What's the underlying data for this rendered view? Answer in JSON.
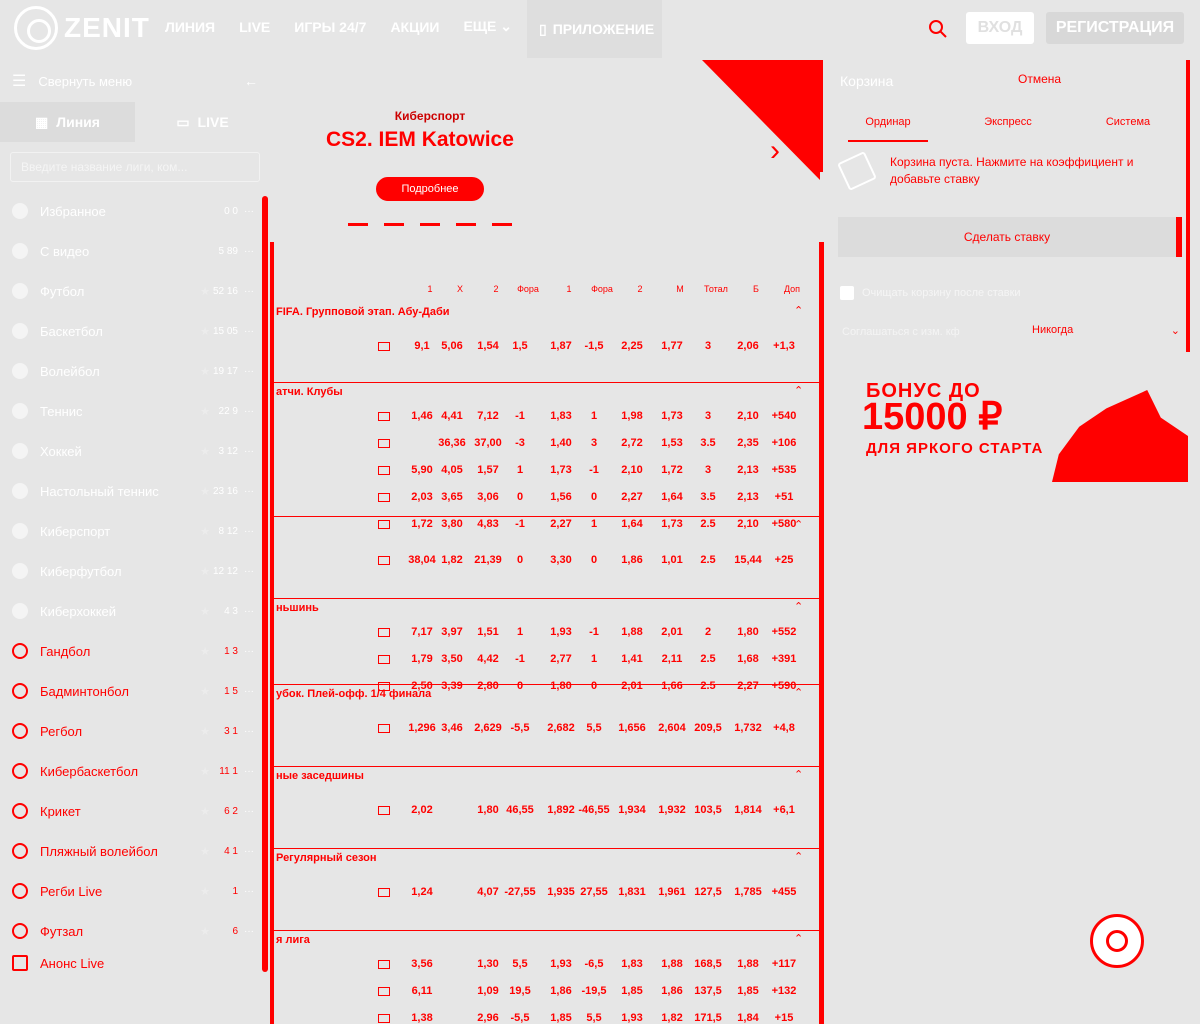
{
  "header": {
    "logo_text": "ZENIT",
    "nav": [
      "Линия",
      "LIVE",
      "Игры 24/7",
      "Акции",
      "Еще"
    ],
    "app_label": "Приложение",
    "login": "Вход",
    "register": "Регистрация"
  },
  "sidebar": {
    "collapse_label": "Свернуть меню",
    "tabs": [
      "Линия",
      "LIVE"
    ],
    "search_placeholder": "Введите название лиги, ком...",
    "sports": [
      {
        "name": "Избранное",
        "count": "0 0"
      },
      {
        "name": "С видео",
        "count": "5 89"
      },
      {
        "name": "Футбол",
        "count": "52 16"
      },
      {
        "name": "Баскетбол",
        "count": "15 05"
      },
      {
        "name": "Волейбол",
        "count": "19 17"
      },
      {
        "name": "Теннис",
        "count": "22 9"
      },
      {
        "name": "Хоккей",
        "count": "3 12"
      },
      {
        "name": "Настольный теннис",
        "count": "23 16"
      },
      {
        "name": "Киберспорт",
        "count": "8 12"
      },
      {
        "name": "Киберфутбол",
        "count": "12 12"
      },
      {
        "name": "Киберхоккей",
        "count": "4 3"
      },
      {
        "name": "Гандбол",
        "count": "1 3"
      },
      {
        "name": "Бадминтонбол",
        "count": "1 5"
      },
      {
        "name": "Регбол",
        "count": "3 1"
      },
      {
        "name": "Кибербаскетбол",
        "count": "11 1"
      },
      {
        "name": "Крикет",
        "count": "6 2"
      },
      {
        "name": "Пляжный волейбол",
        "count": "4 1"
      },
      {
        "name": "Регби Live",
        "count": "1"
      },
      {
        "name": "Футзал",
        "count": "6"
      }
    ],
    "announce": "Анонс Live"
  },
  "banner": {
    "subtitle": "Киберспорт",
    "title": "CS2. IEM Katowice",
    "button": "Подробнее"
  },
  "odds": {
    "columns": [
      "1",
      "X",
      "2",
      "Фора",
      "1",
      "Фора",
      "2",
      "М",
      "Тотал",
      "Б",
      "Доп"
    ],
    "leagues": [
      {
        "name": "FIFA. Групповой этап. Абу-Даби",
        "rows": [
          [
            "9,1",
            "5,06",
            "1,54",
            "1,5",
            "1,87",
            "-1,5",
            "2,25",
            "1,77",
            "3",
            "2,06",
            "+1,3"
          ]
        ]
      },
      {
        "name": "атчи. Клубы",
        "rows": [
          [
            "1,46",
            "4,41",
            "7,12",
            "-1",
            "1,83",
            "1",
            "1,98",
            "1,73",
            "3",
            "2,10",
            "+540"
          ],
          [
            "",
            "36,36",
            "37,00",
            "-3",
            "1,40",
            "3",
            "2,72",
            "1,53",
            "3.5",
            "2,35",
            "+106"
          ],
          [
            "5,90",
            "4,05",
            "1,57",
            "1",
            "1,73",
            "-1",
            "2,10",
            "1,72",
            "3",
            "2,13",
            "+535"
          ],
          [
            "2,03",
            "3,65",
            "3,06",
            "0",
            "1,56",
            "0",
            "2,27",
            "1,64",
            "3.5",
            "2,13",
            "+51"
          ],
          [
            "1,72",
            "3,80",
            "4,83",
            "-1",
            "2,27",
            "1",
            "1,64",
            "1,73",
            "2.5",
            "2,10",
            "+580"
          ]
        ]
      },
      {
        "name": "",
        "rows": [
          [
            "38,04",
            "1,82",
            "21,39",
            "0",
            "3,30",
            "0",
            "1,86",
            "1,01",
            "2.5",
            "15,44",
            "+25"
          ]
        ]
      },
      {
        "name": "ньшинь",
        "rows": [
          [
            "7,17",
            "3,97",
            "1,51",
            "1",
            "1,93",
            "-1",
            "1,88",
            "2,01",
            "2",
            "1,80",
            "+552"
          ],
          [
            "1,79",
            "3,50",
            "4,42",
            "-1",
            "2,77",
            "1",
            "1,41",
            "2,11",
            "2.5",
            "1,68",
            "+391"
          ],
          [
            "2,50",
            "3,39",
            "2,80",
            "0",
            "1,80",
            "0",
            "2,01",
            "1,66",
            "2.5",
            "2,27",
            "+590"
          ]
        ]
      },
      {
        "name": "убок. Плей-офф. 1/4 финала",
        "rows": [
          [
            "1,296",
            "3,46",
            "2,629",
            "-5,5",
            "2,682",
            "5,5",
            "1,656",
            "2,604",
            "209,5",
            "1,732",
            "+4,8"
          ]
        ]
      },
      {
        "name": "ные заседшины",
        "rows": [
          [
            "2,02",
            "",
            "1,80",
            "46,55",
            "1,892",
            "-46,55",
            "1,934",
            "1,932",
            "103,5",
            "1,814",
            "+6,1"
          ]
        ]
      },
      {
        "name": "Регулярный сезон",
        "rows": [
          [
            "1,24",
            "",
            "4,07",
            "-27,55",
            "1,935",
            "27,55",
            "1,831",
            "1,961",
            "127,5",
            "1,785",
            "+455"
          ]
        ]
      },
      {
        "name": "я лига",
        "rows": [
          [
            "3,56",
            "",
            "1,30",
            "5,5",
            "1,93",
            "-6,5",
            "1,83",
            "1,88",
            "168,5",
            "1,88",
            "+117"
          ],
          [
            "6,11",
            "",
            "1,09",
            "19,5",
            "1,86",
            "-19,5",
            "1,85",
            "1,86",
            "137,5",
            "1,85",
            "+132"
          ],
          [
            "1,38",
            "",
            "2,96",
            "-5,5",
            "1,85",
            "5,5",
            "1,93",
            "1,82",
            "171,5",
            "1,84",
            "+15"
          ]
        ]
      }
    ]
  },
  "cart": {
    "title": "Корзина",
    "settings_btn": "Отмена",
    "tabs": [
      "Ординар",
      "Экспресс",
      "Система"
    ],
    "empty_text": "Корзина пуста. Нажмите на коэффициент и добавьте ставку",
    "submit": "Сделать ставку",
    "clear_after": "Очищать корзину после ставки",
    "agree_label": "Соглашаться с изм. кф",
    "agree_value": "Никогда"
  },
  "promo": {
    "line1": "БОНУС ДО",
    "line2": "15000 ₽",
    "line3": "ДЛЯ ЯРКОГО СТАРТА"
  },
  "colors": {
    "accent": "#ff0000",
    "background": "#e6e6e6"
  }
}
